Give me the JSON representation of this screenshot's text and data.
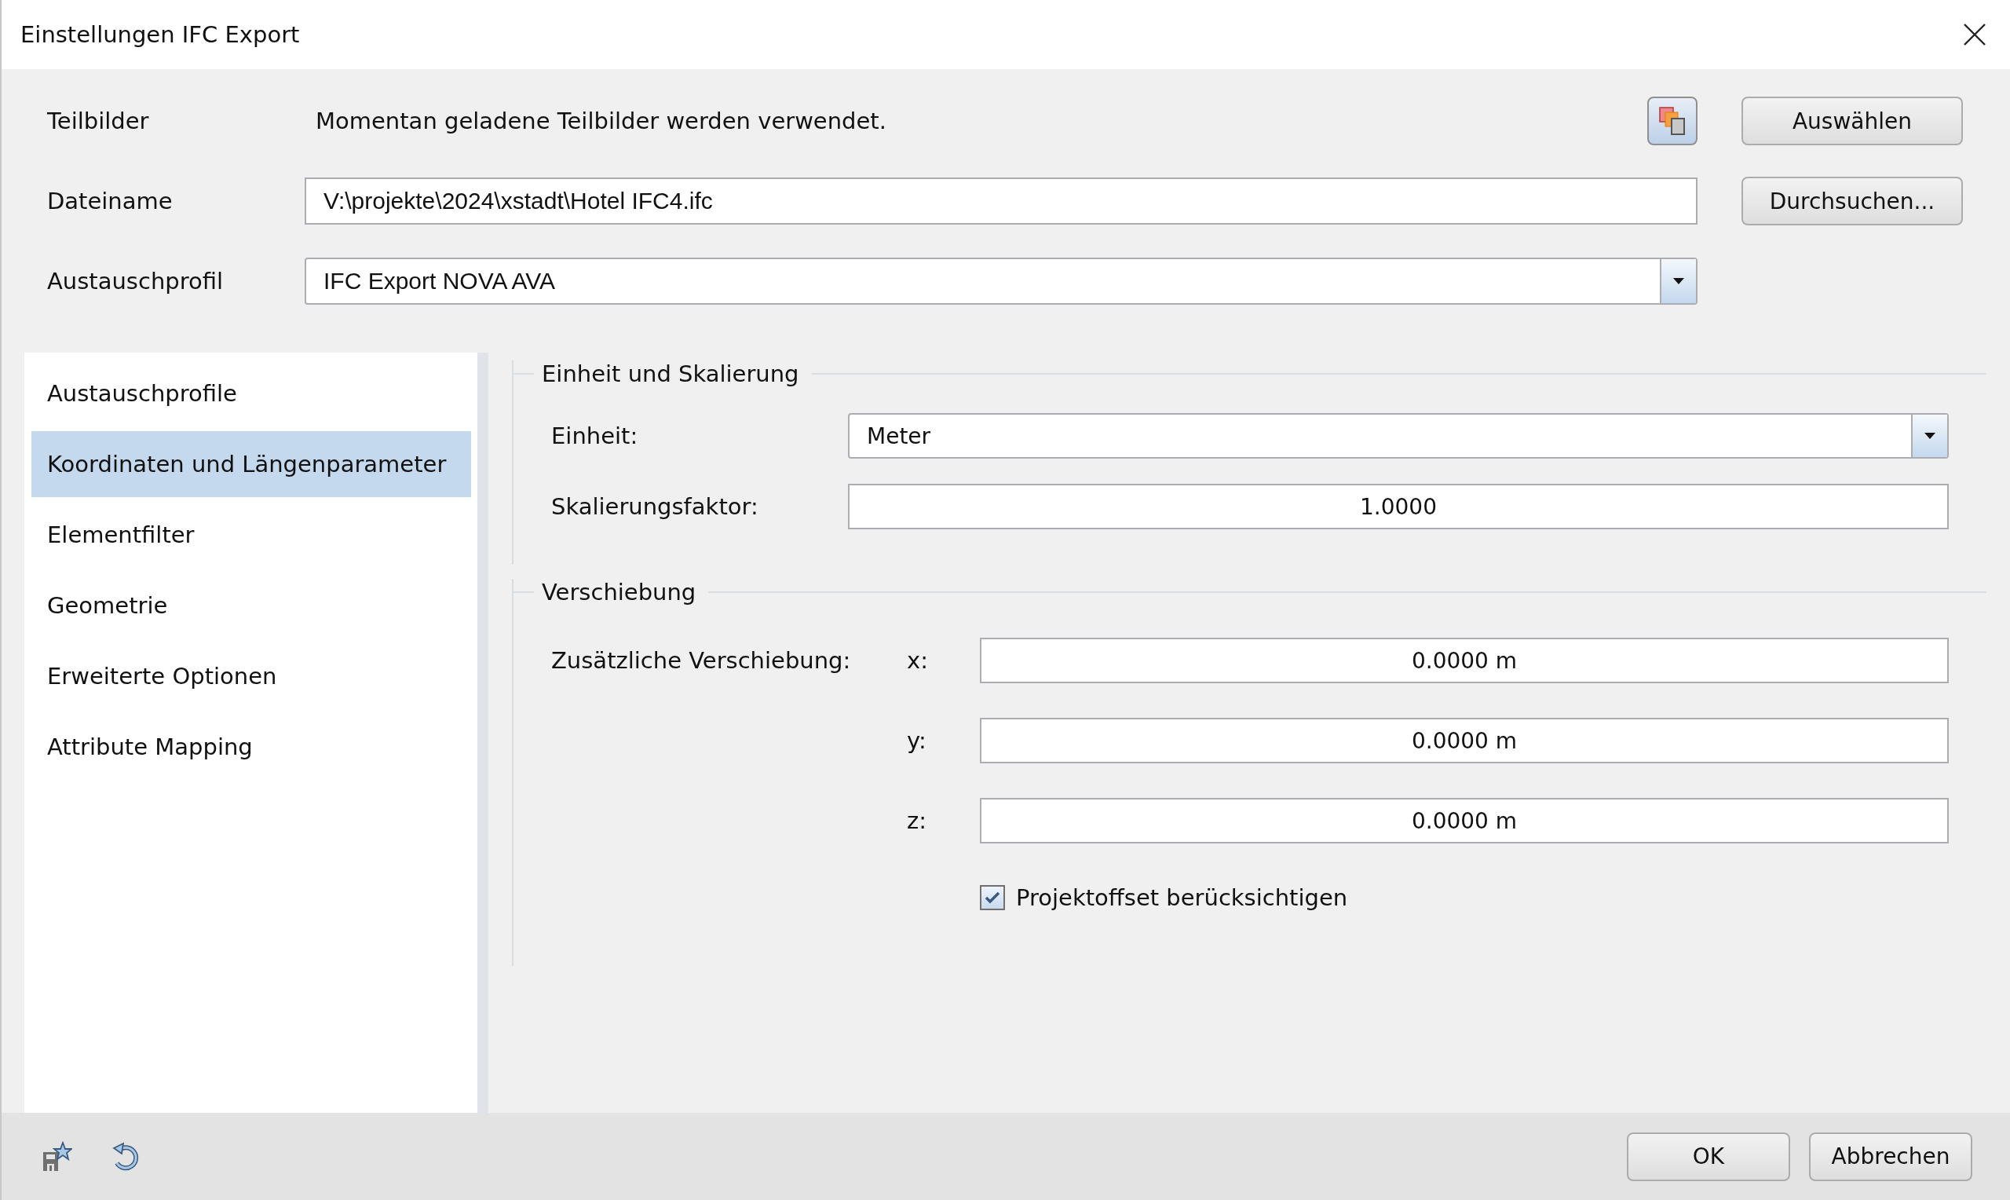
{
  "window": {
    "title": "Einstellungen IFC Export"
  },
  "rows": [
    {
      "kind": "text",
      "label": "Teilbilder",
      "text": "Momentan geladene Teilbilder werden verwendet.",
      "button": "Auswählen"
    },
    {
      "kind": "input",
      "label": "Dateiname",
      "value": "V:\\projekte\\2024\\xstadt\\Hotel IFC4.ifc",
      "button": "Durchsuchen..."
    },
    {
      "kind": "combo",
      "label": "Austauschprofil",
      "value": "IFC Export NOVA AVA"
    }
  ],
  "nav": [
    {
      "label": "Austauschprofile",
      "selected": false
    },
    {
      "label": "Koordinaten und Längenparameter",
      "selected": true
    },
    {
      "label": "Elementfilter",
      "selected": false
    },
    {
      "label": "Geometrie",
      "selected": false
    },
    {
      "label": "Erweiterte Optionen",
      "selected": false
    },
    {
      "label": "Attribute Mapping",
      "selected": false
    }
  ],
  "groups": [
    {
      "title": "Einheit und Skalierung",
      "fields": [
        {
          "kind": "combo",
          "label": "Einheit:",
          "value": "Meter"
        },
        {
          "kind": "input",
          "label": "Skalierungsfaktor:",
          "value": "1.0000"
        }
      ]
    },
    {
      "title": "Verschiebung",
      "fields": [
        {
          "kind": "axis",
          "label": "Zusätzliche Verschiebung:",
          "axis": "x:",
          "value": "0.0000 m"
        },
        {
          "kind": "axis",
          "axis": "y:",
          "value": "0.0000 m"
        },
        {
          "kind": "axis",
          "axis": "z:",
          "value": "0.0000 m"
        }
      ],
      "checkbox": {
        "label": "Projektoffset berücksichtigen",
        "checked": true
      }
    }
  ],
  "footer": {
    "buttons": [
      "OK",
      "Abbrechen"
    ]
  }
}
